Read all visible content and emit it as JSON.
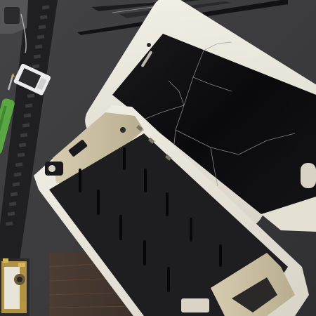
{
  "scene": {
    "description_free": true,
    "colors": {
      "mat": "#3b3b3d",
      "mat_dark": "#2c2c2e",
      "phone_frame": "#e9e6dc",
      "screen_black": "#0b0b0d",
      "midframe_gold": "#c9bfa4",
      "midframe_panel": "#1e1d1f",
      "tool_green": "#5aa642",
      "tool_black": "#141416",
      "board_gold": "#c8a44a"
    },
    "objects": [
      {
        "name": "repair-mat",
        "icon": "mat-icon"
      },
      {
        "name": "screwdriver-tools",
        "icon": "screwdriver-icon"
      },
      {
        "name": "broken-phone-screen",
        "icon": "cracked-screen-icon"
      },
      {
        "name": "phone-midframe",
        "icon": "phone-frame-icon"
      },
      {
        "name": "sim-tray",
        "icon": "sim-tray-icon"
      },
      {
        "name": "circuit-board",
        "icon": "circuit-board-icon"
      }
    ]
  }
}
